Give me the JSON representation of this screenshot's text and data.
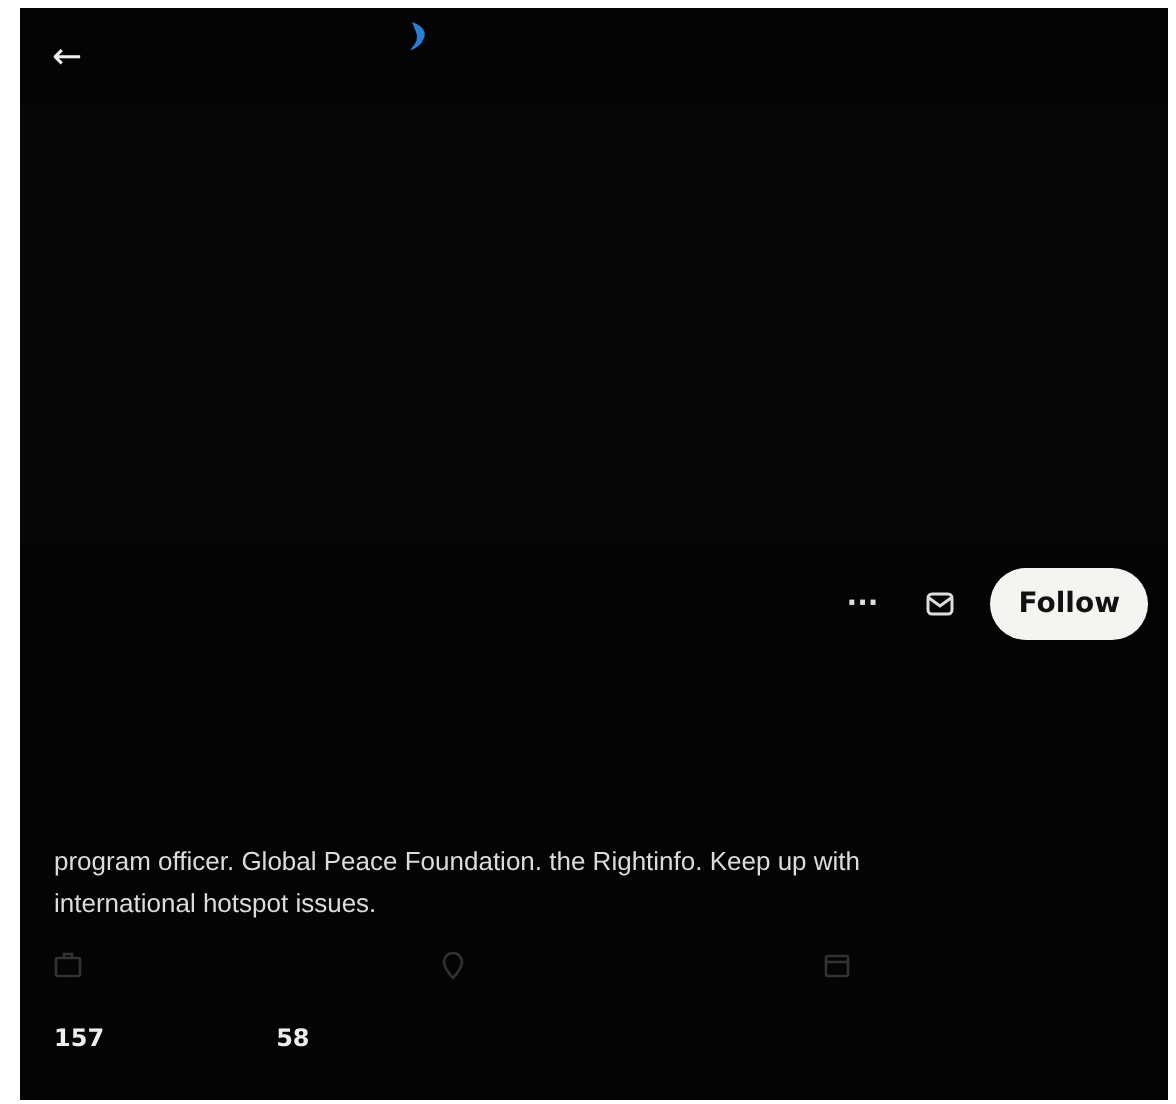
{
  "header": {
    "back": "←"
  },
  "actions": {
    "more": "···",
    "follow": "Follow"
  },
  "bio": "program officer. Global Peace Foundation. the Rightinfo. Keep up with international hotspot issues.",
  "stats": [
    {
      "count": "157"
    },
    {
      "count": "58"
    }
  ]
}
